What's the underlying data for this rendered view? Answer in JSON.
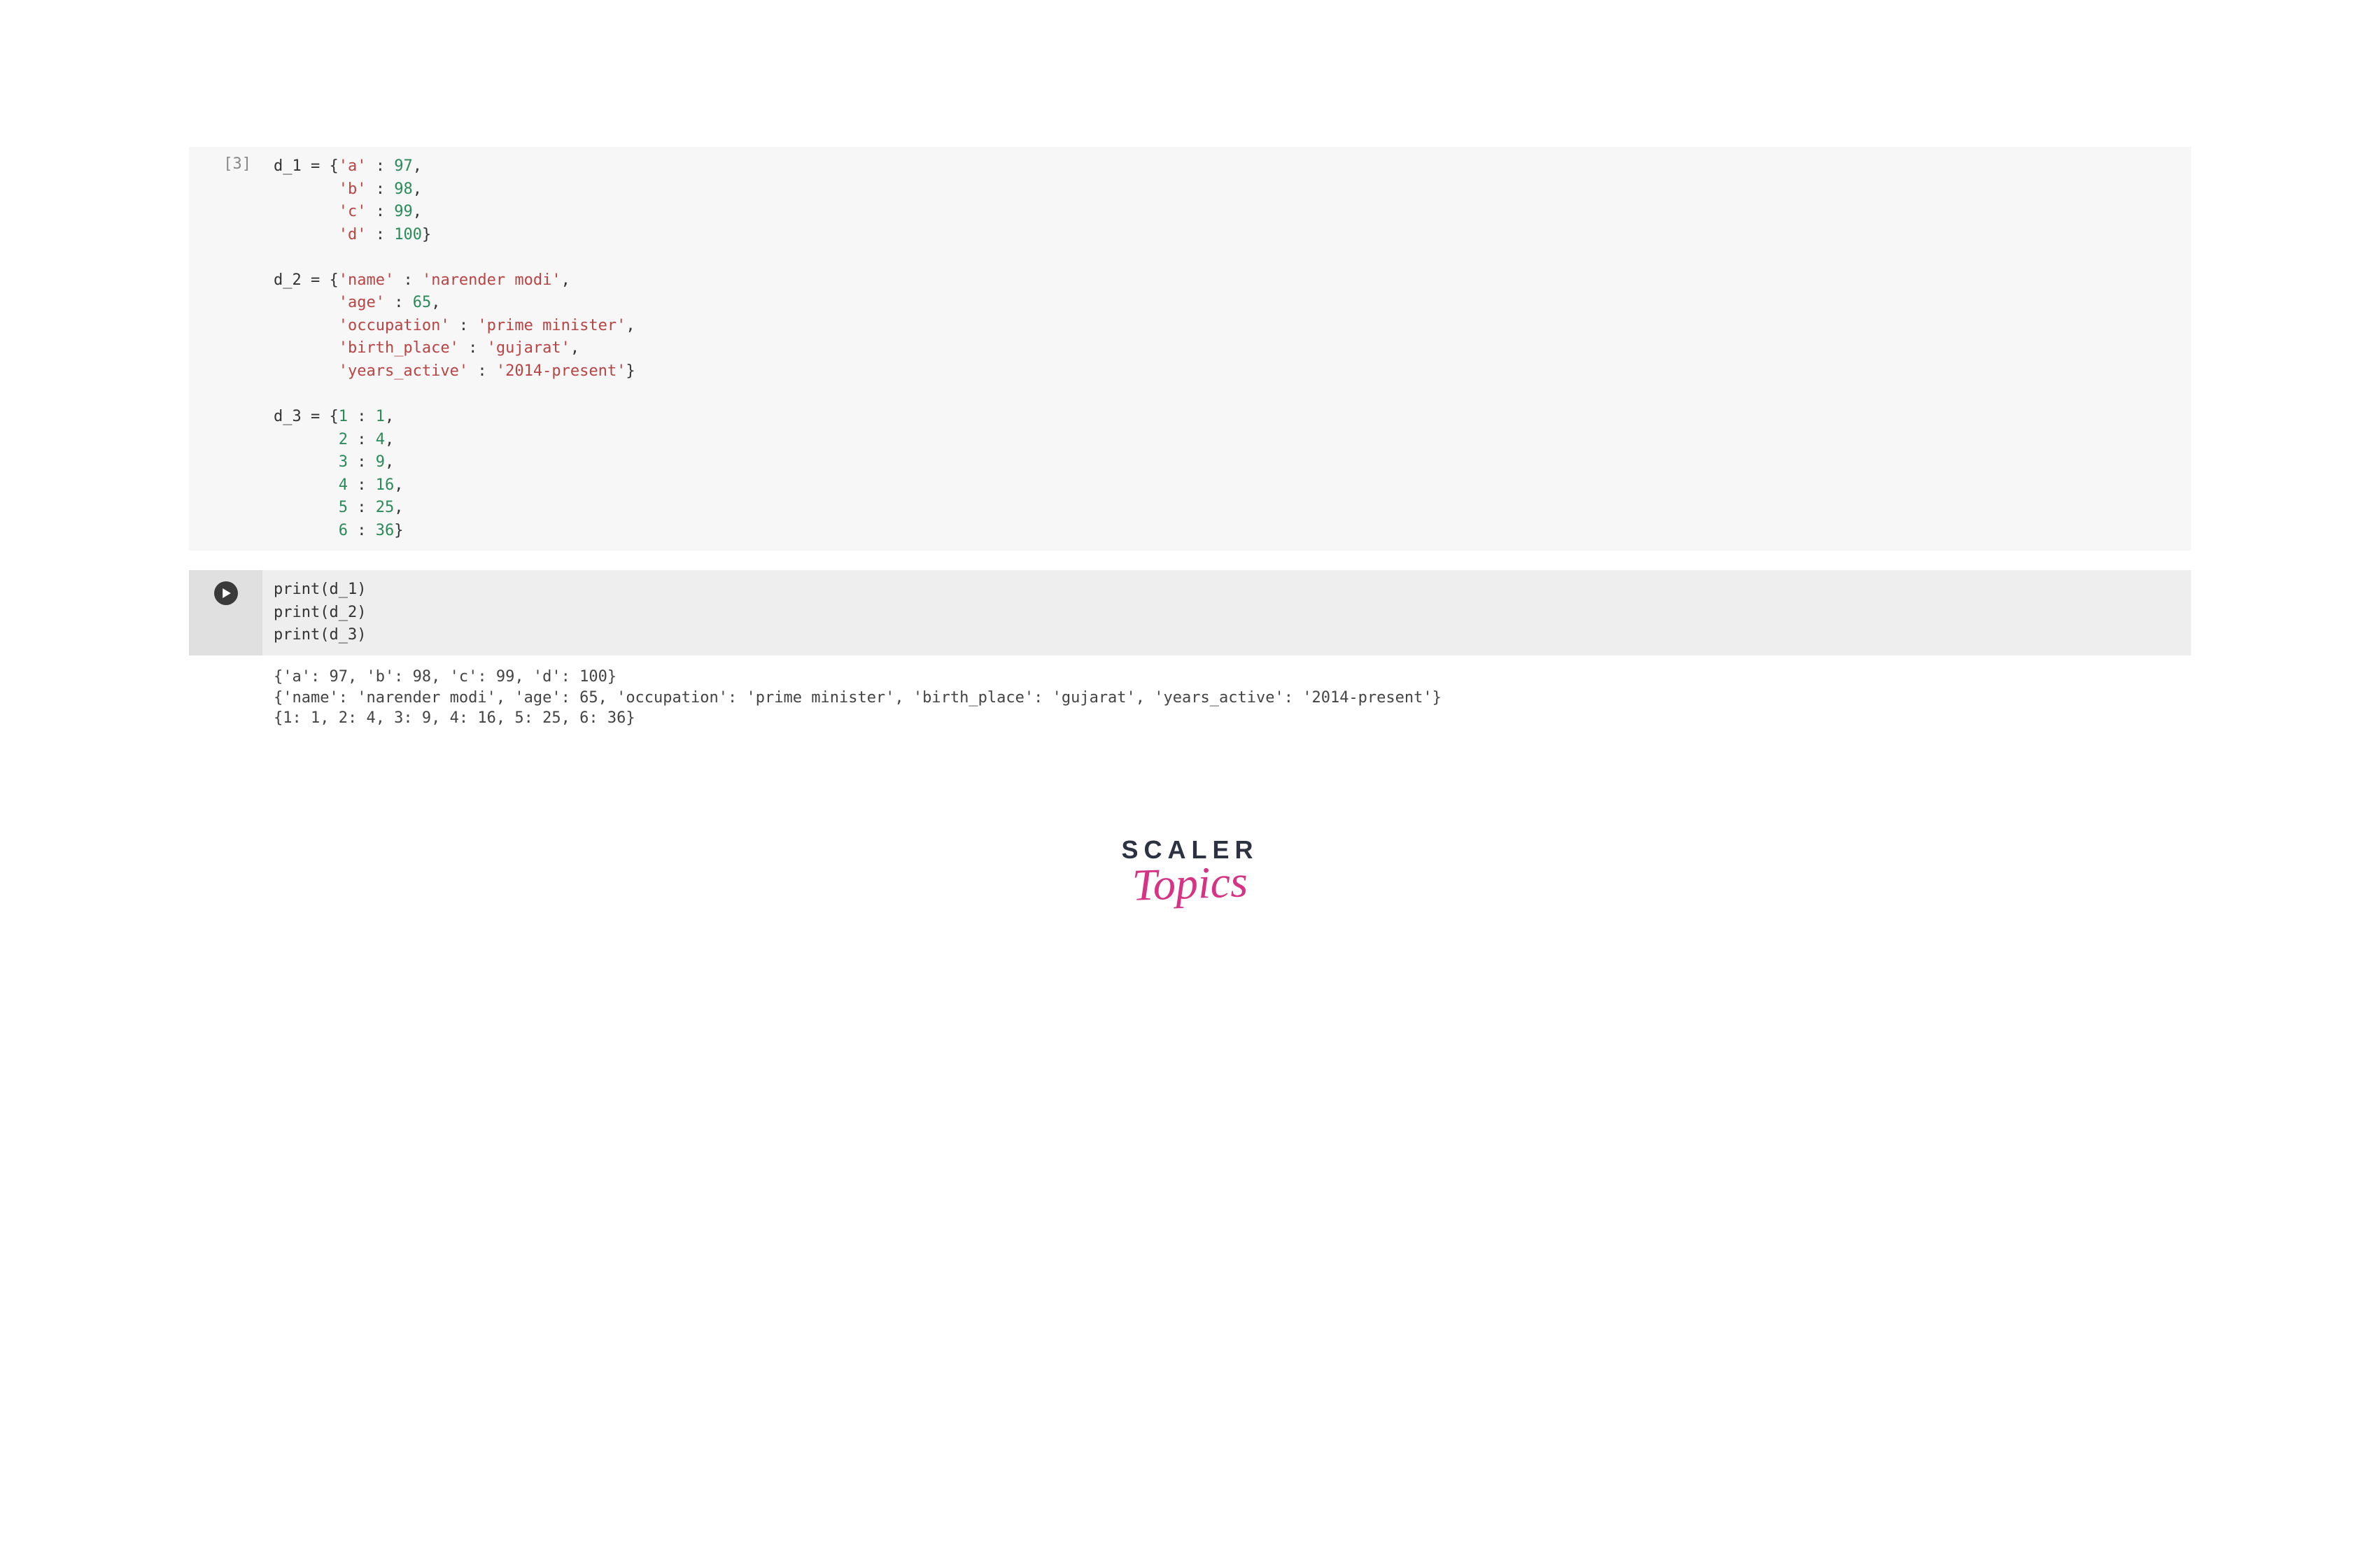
{
  "cell1": {
    "exec_count": "[3]",
    "code_tokens": [
      {
        "t": "ident",
        "v": "d_1 = {"
      },
      {
        "t": "str",
        "v": "'a'"
      },
      {
        "t": "punct",
        "v": " : "
      },
      {
        "t": "num",
        "v": "97"
      },
      {
        "t": "punct",
        "v": ",\n"
      },
      {
        "t": "punct",
        "v": "       "
      },
      {
        "t": "str",
        "v": "'b'"
      },
      {
        "t": "punct",
        "v": " : "
      },
      {
        "t": "num",
        "v": "98"
      },
      {
        "t": "punct",
        "v": ",\n"
      },
      {
        "t": "punct",
        "v": "       "
      },
      {
        "t": "str",
        "v": "'c'"
      },
      {
        "t": "punct",
        "v": " : "
      },
      {
        "t": "num",
        "v": "99"
      },
      {
        "t": "punct",
        "v": ",\n"
      },
      {
        "t": "punct",
        "v": "       "
      },
      {
        "t": "str",
        "v": "'d'"
      },
      {
        "t": "punct",
        "v": " : "
      },
      {
        "t": "num",
        "v": "100"
      },
      {
        "t": "punct",
        "v": "}\n\n"
      },
      {
        "t": "ident",
        "v": "d_2 = {"
      },
      {
        "t": "str",
        "v": "'name'"
      },
      {
        "t": "punct",
        "v": " : "
      },
      {
        "t": "str",
        "v": "'narender modi'"
      },
      {
        "t": "punct",
        "v": ",\n"
      },
      {
        "t": "punct",
        "v": "       "
      },
      {
        "t": "str",
        "v": "'age'"
      },
      {
        "t": "punct",
        "v": " : "
      },
      {
        "t": "num",
        "v": "65"
      },
      {
        "t": "punct",
        "v": ",\n"
      },
      {
        "t": "punct",
        "v": "       "
      },
      {
        "t": "str",
        "v": "'occupation'"
      },
      {
        "t": "punct",
        "v": " : "
      },
      {
        "t": "str",
        "v": "'prime minister'"
      },
      {
        "t": "punct",
        "v": ",\n"
      },
      {
        "t": "punct",
        "v": "       "
      },
      {
        "t": "str",
        "v": "'birth_place'"
      },
      {
        "t": "punct",
        "v": " : "
      },
      {
        "t": "str",
        "v": "'gujarat'"
      },
      {
        "t": "punct",
        "v": ",\n"
      },
      {
        "t": "punct",
        "v": "       "
      },
      {
        "t": "str",
        "v": "'years_active'"
      },
      {
        "t": "punct",
        "v": " : "
      },
      {
        "t": "str",
        "v": "'2014-present'"
      },
      {
        "t": "punct",
        "v": "}\n\n"
      },
      {
        "t": "ident",
        "v": "d_3 = {"
      },
      {
        "t": "num",
        "v": "1"
      },
      {
        "t": "punct",
        "v": " : "
      },
      {
        "t": "num",
        "v": "1"
      },
      {
        "t": "punct",
        "v": ",\n"
      },
      {
        "t": "punct",
        "v": "       "
      },
      {
        "t": "num",
        "v": "2"
      },
      {
        "t": "punct",
        "v": " : "
      },
      {
        "t": "num",
        "v": "4"
      },
      {
        "t": "punct",
        "v": ",\n"
      },
      {
        "t": "punct",
        "v": "       "
      },
      {
        "t": "num",
        "v": "3"
      },
      {
        "t": "punct",
        "v": " : "
      },
      {
        "t": "num",
        "v": "9"
      },
      {
        "t": "punct",
        "v": ",\n"
      },
      {
        "t": "punct",
        "v": "       "
      },
      {
        "t": "num",
        "v": "4"
      },
      {
        "t": "punct",
        "v": " : "
      },
      {
        "t": "num",
        "v": "16"
      },
      {
        "t": "punct",
        "v": ",\n"
      },
      {
        "t": "punct",
        "v": "       "
      },
      {
        "t": "num",
        "v": "5"
      },
      {
        "t": "punct",
        "v": " : "
      },
      {
        "t": "num",
        "v": "25"
      },
      {
        "t": "punct",
        "v": ",\n"
      },
      {
        "t": "punct",
        "v": "       "
      },
      {
        "t": "num",
        "v": "6"
      },
      {
        "t": "punct",
        "v": " : "
      },
      {
        "t": "num",
        "v": "36"
      },
      {
        "t": "punct",
        "v": "}"
      }
    ]
  },
  "cell2": {
    "code_tokens": [
      {
        "t": "builtin",
        "v": "print"
      },
      {
        "t": "punct",
        "v": "(d_1)\n"
      },
      {
        "t": "builtin",
        "v": "print"
      },
      {
        "t": "punct",
        "v": "(d_2)\n"
      },
      {
        "t": "builtin",
        "v": "print"
      },
      {
        "t": "punct",
        "v": "(d_3)"
      }
    ]
  },
  "output": {
    "lines": [
      "{'a': 97, 'b': 98, 'c': 99, 'd': 100}",
      "{'name': 'narender modi', 'age': 65, 'occupation': 'prime minister', 'birth_place': 'gujarat', 'years_active': '2014-present'}",
      "{1: 1, 2: 4, 3: 9, 4: 16, 5: 25, 6: 36}"
    ]
  },
  "logo": {
    "line1": "SCALER",
    "line2": "Topics"
  }
}
